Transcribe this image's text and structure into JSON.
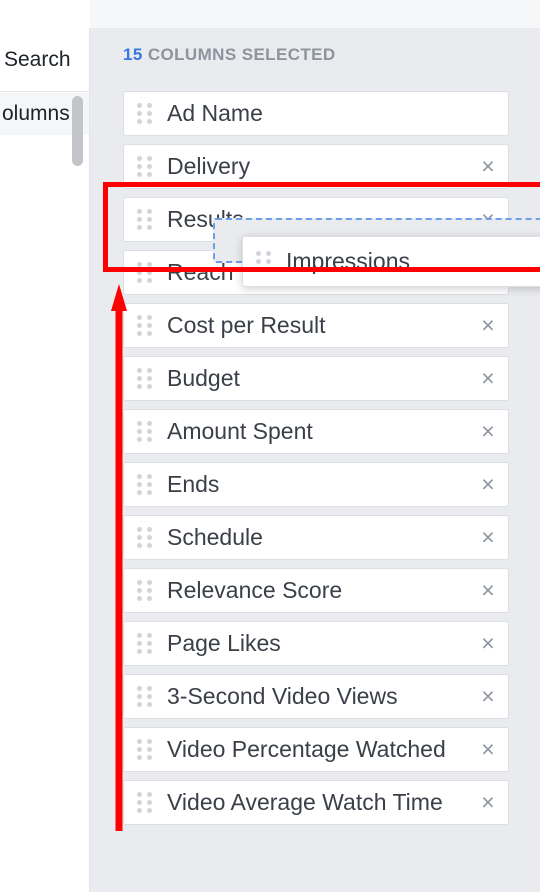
{
  "window": {
    "collapse_icon": "chevron-up-icon",
    "collapse_glyph": "⌃"
  },
  "left_panel": {
    "search_label": "Search",
    "nav_item_label": "olumns",
    "scrollbar": "vertical-scrollbar"
  },
  "columns_panel": {
    "header": {
      "count": "15",
      "label": "COLUMNS SELECTED"
    },
    "remove_glyph": "×",
    "selected_columns": [
      {
        "label": "Ad Name",
        "removable": false
      },
      {
        "label": "Delivery",
        "removable": true
      },
      {
        "label": "Results",
        "removable": true
      },
      {
        "label": "Reach",
        "removable": true
      },
      {
        "label": "Cost per Result",
        "removable": true
      },
      {
        "label": "Budget",
        "removable": true
      },
      {
        "label": "Amount Spent",
        "removable": true
      },
      {
        "label": "Ends",
        "removable": true
      },
      {
        "label": "Schedule",
        "removable": true
      },
      {
        "label": "Relevance Score",
        "removable": true
      },
      {
        "label": "Page Likes",
        "removable": true
      },
      {
        "label": "3-Second Video Views",
        "removable": true
      },
      {
        "label": "Video Percentage Watched",
        "removable": true
      },
      {
        "label": "Video Average Watch Time",
        "removable": true
      }
    ],
    "drag": {
      "dragged_label": "Impressions",
      "removable": true
    }
  },
  "annotations": {
    "highlight_color": "#ff0000",
    "rectangle": "drag-target-highlight",
    "arrow": "reorder-direction-arrow"
  }
}
